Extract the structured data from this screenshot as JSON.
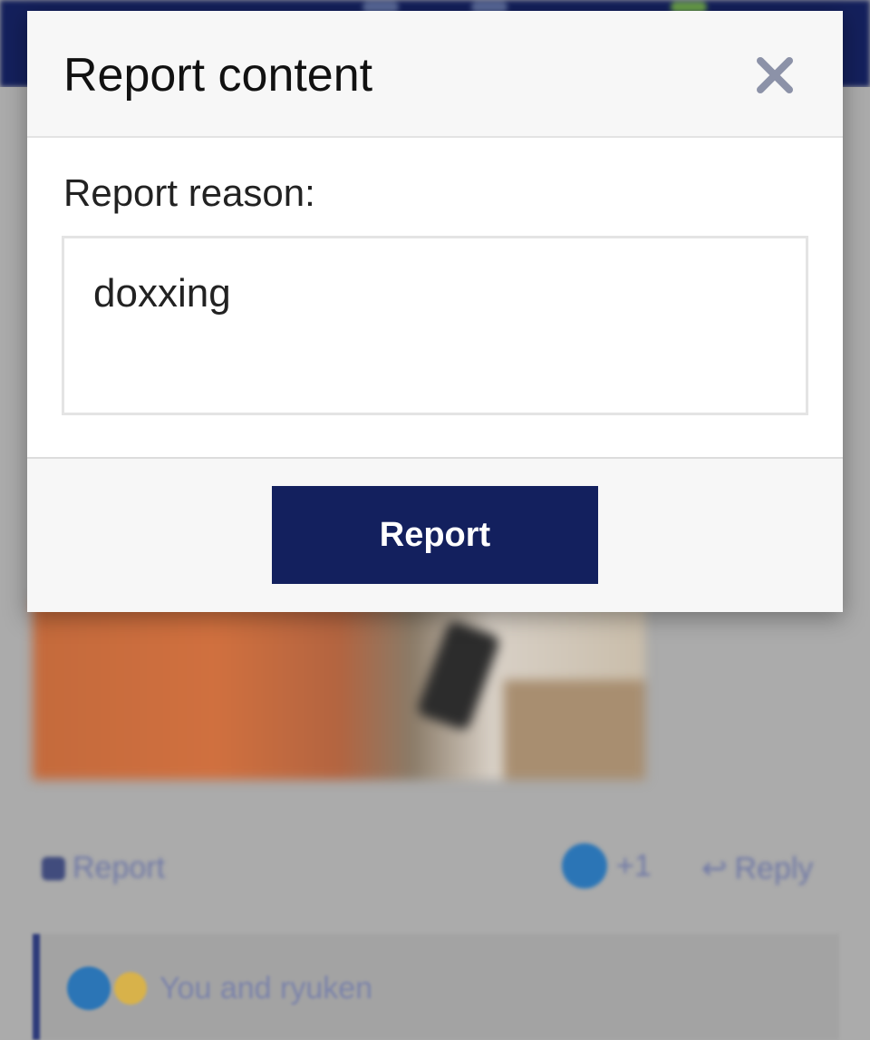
{
  "modal": {
    "title": "Report content",
    "reason_label": "Report reason:",
    "reason_value": "doxxing",
    "submit_label": "Report"
  },
  "background": {
    "report_link": "Report",
    "reaction_count": "+1",
    "reply_link": "Reply",
    "reactions_text": "You and ryuken"
  },
  "colors": {
    "accent": "#13205e",
    "close_icon": "#8c92a8",
    "reaction_blue": "#2b75b6"
  },
  "icons": {
    "close": "close-icon",
    "lock": "lock-icon",
    "like_reaction": "like-reaction-icon",
    "reply": "reply-icon"
  }
}
